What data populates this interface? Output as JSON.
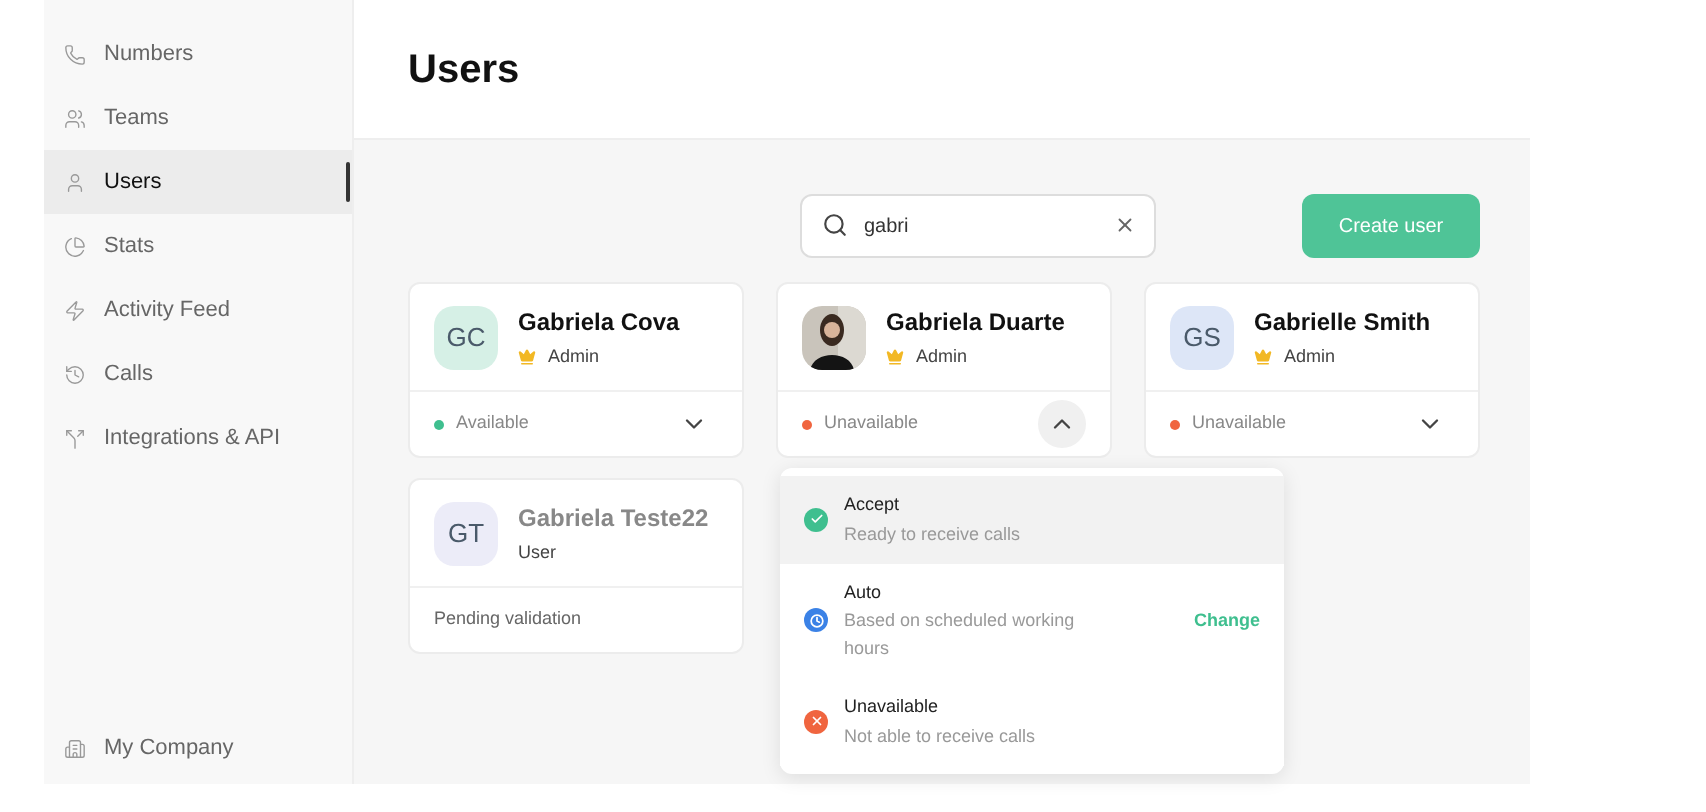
{
  "sidebar": {
    "items": [
      {
        "label": "Numbers",
        "selected": false
      },
      {
        "label": "Teams",
        "selected": false
      },
      {
        "label": "Users",
        "selected": true
      },
      {
        "label": "Stats",
        "selected": false
      },
      {
        "label": "Activity Feed",
        "selected": false
      },
      {
        "label": "Calls",
        "selected": false
      },
      {
        "label": "Integrations & API",
        "selected": false
      }
    ],
    "footer": {
      "label": "My Company"
    }
  },
  "page": {
    "title": "Users"
  },
  "search": {
    "value": "gabri"
  },
  "create_button": "Create user",
  "users": [
    {
      "name": "Gabriela Cova",
      "initials": "GC",
      "role": "Admin",
      "admin": true,
      "pending": false,
      "status": "Available",
      "color": "#3fbf8f",
      "expanded": false
    },
    {
      "name": "Gabriela Duarte",
      "role": "Admin",
      "admin": true,
      "pending": false,
      "status": "Unavailable",
      "color": "#f0653f",
      "expanded": true
    },
    {
      "name": "Gabrielle Smith",
      "initials": "GS",
      "role": "Admin",
      "admin": true,
      "pending": false,
      "status": "Unavailable",
      "color": "#f0653f",
      "expanded": false
    },
    {
      "name": "Gabriela Teste22",
      "initials": "GT",
      "role": "User",
      "admin": false,
      "pending": true,
      "footer": "Pending validation"
    }
  ],
  "status_menu": [
    {
      "kind": "accept",
      "title": "Accept",
      "subtitle": "Ready to receive calls",
      "selected": true
    },
    {
      "kind": "auto",
      "title": "Auto",
      "subtitle": "Based on scheduled working hours",
      "action": "Change",
      "selected": false
    },
    {
      "kind": "unavailable",
      "title": "Unavailable",
      "subtitle": "Not able to receive calls",
      "selected": false
    }
  ]
}
